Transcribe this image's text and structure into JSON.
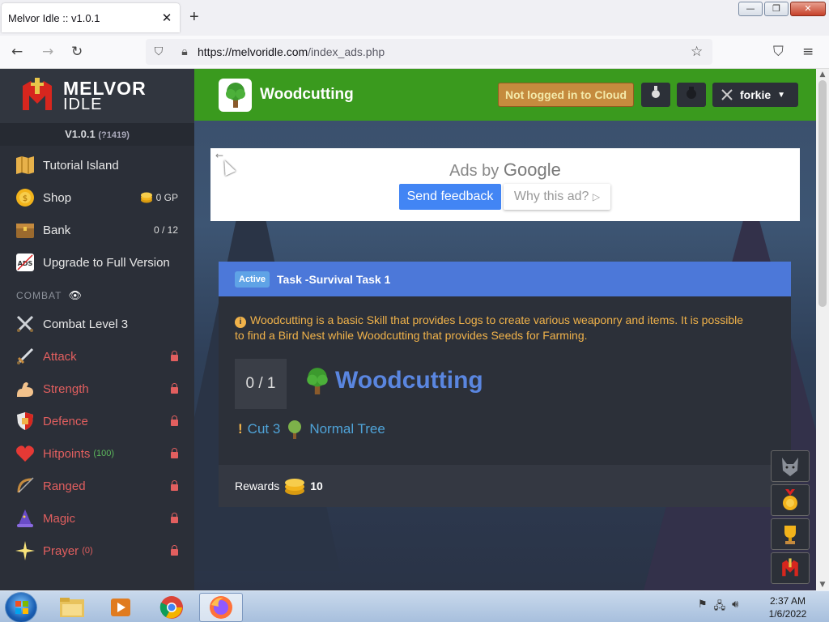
{
  "browser": {
    "tab_title": "Melvor Idle :: v1.0.1",
    "tab_close": "✕",
    "new_tab": "+",
    "url_host": "https://melvoridle.com",
    "url_path": "/index_ads.php",
    "window_controls": [
      "—",
      "❐",
      "✕"
    ]
  },
  "sidebar": {
    "logo_line1": "MELVOR",
    "logo_line2": "IDLE",
    "version": "V1.0.1",
    "build": "(?1419)",
    "top_items": [
      {
        "label": "Tutorial Island",
        "icon": "map-icon",
        "right": ""
      },
      {
        "label": "Shop",
        "icon": "coin-icon",
        "right": "0 GP"
      },
      {
        "label": "Bank",
        "icon": "chest-icon",
        "right": "0 / 12"
      },
      {
        "label": "Upgrade to Full Version",
        "icon": "ads-icon",
        "right": ""
      }
    ],
    "combat_header": "COMBAT",
    "combat_level": "Combat Level 3",
    "skills": [
      {
        "label": "Attack",
        "icon": "sword-icon",
        "sub": ""
      },
      {
        "label": "Strength",
        "icon": "arm-icon",
        "sub": ""
      },
      {
        "label": "Defence",
        "icon": "shield-icon",
        "sub": ""
      },
      {
        "label": "Hitpoints",
        "icon": "heart-icon",
        "sub": "(100)"
      },
      {
        "label": "Ranged",
        "icon": "bow-icon",
        "sub": ""
      },
      {
        "label": "Magic",
        "icon": "wizard-hat-icon",
        "sub": ""
      },
      {
        "label": "Prayer",
        "icon": "sparkle-icon",
        "sub": "(0)"
      }
    ]
  },
  "header": {
    "title": "Woodcutting",
    "cloud_status": "Not logged in to Cloud",
    "username": "forkie"
  },
  "ad": {
    "back": "←",
    "ads_by": "Ads by",
    "google": "Google",
    "feedback": "Send feedback",
    "why": "Why this ad?",
    "why_icon": "▷"
  },
  "task": {
    "badge": "Active",
    "title": "Task -Survival Task 1",
    "info": "Woodcutting is a basic Skill that provides Logs to create various weaponry and items. It is possible to find a Bird Nest while Woodcutting that provides Seeds for Farming.",
    "progress": "0 / 1",
    "skill": "Woodcutting",
    "req_prefix": "!",
    "req_action": "Cut 3",
    "req_target": "Normal Tree",
    "rewards_label": "Rewards",
    "rewards_amount": "10"
  },
  "taskbar": {
    "time": "2:37 AM",
    "date": "1/6/2022"
  },
  "colors": {
    "header_green": "#3a9a1e",
    "task_blue": "#4c78d9",
    "skill_red": "#e25f5f",
    "info_orange": "#f0b24a"
  }
}
